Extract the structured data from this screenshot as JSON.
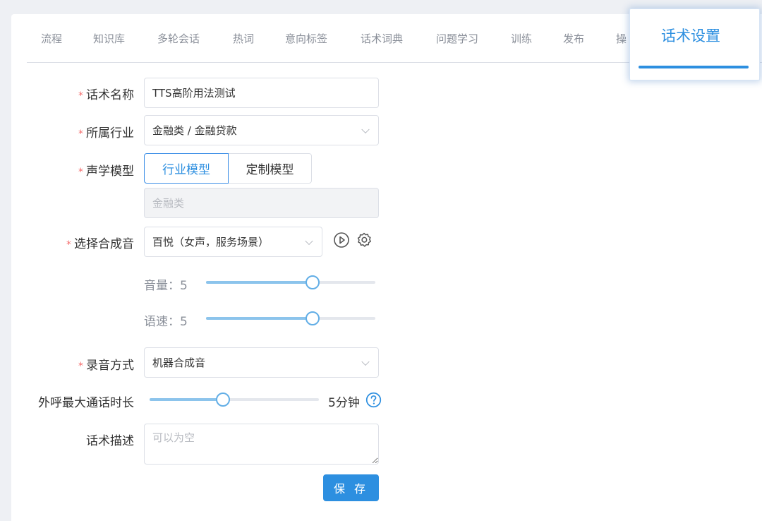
{
  "tabs": [
    "流程",
    "知识库",
    "多轮会话",
    "热词",
    "意向标签",
    "话术词典",
    "问题学习",
    "训练",
    "发布",
    "操"
  ],
  "active_tab": "话术设置",
  "form": {
    "name_label": "话术名称",
    "name_value": "TTS高阶用法测试",
    "industry_label": "所属行业",
    "industry_value": "金融类 / 金融贷款",
    "model_label": "声学模型",
    "model_options": [
      "行业模型",
      "定制模型"
    ],
    "model_selected": "行业模型",
    "model_value": "金融类",
    "voice_label": "选择合成音",
    "voice_value": "百悦（女声，服务场景）",
    "volume_label": "音量：5",
    "volume_value": 5,
    "speed_label": "语速：5",
    "speed_value": 5,
    "slider_max": 8,
    "record_label": "录音方式",
    "record_value": "机器合成音",
    "max_duration_label": "外呼最大通话时长",
    "max_duration_text": "5分钟",
    "max_duration_fraction": 0.43,
    "desc_label": "话术描述",
    "desc_placeholder": "可以为空",
    "save_label": "保 存",
    "required_mark": "*"
  },
  "colors": {
    "accent": "#2d8fe0",
    "required": "#f56c6c"
  },
  "icons": [
    "play-circle-icon",
    "gear-icon",
    "help-circle-icon",
    "chevron-down-icon"
  ]
}
